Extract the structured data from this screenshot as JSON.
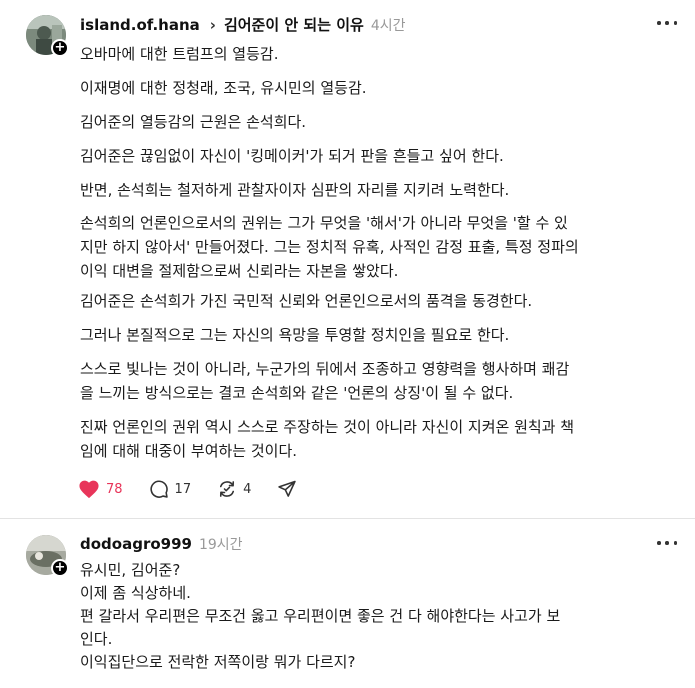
{
  "post": {
    "username": "island.of.hana",
    "separator": "›",
    "topic": "김어준이 안 되는 이유",
    "time": "4시간",
    "paragraphs": [
      "오바마에 대한 트럼프의 열등감.",
      "이재명에 대한 정청래, 조국, 유시민의 열등감.",
      "김어준의 열등감의 근원은 손석희다.",
      "김어준은 끊임없이 자신이 '킹메이커'가 되거 판을 흔들고 싶어 한다.",
      "반면, 손석희는 철저하게 관찰자이자 심판의 자리를 지키려 노력한다.",
      "손석희의 언론인으로서의 권위는 그가 무엇을 '해서'가 아니라 무엇을 '할 수 있",
      "지만 하지 않아서' 만들어졌다. 그는 정치적 유혹, 사적인 감정 표출, 특정 정파의",
      "이익 대변을 절제함으로써 신뢰라는 자본을 쌓았다.",
      "김어준은 손석희가 가진 국민적 신뢰와 언론인으로서의 품격을 동경한다.",
      "그러나 본질적으로 그는 자신의 욕망을 투영할 정치인을 필요로 한다.",
      "스스로 빛나는 것이 아니라, 누군가의 뒤에서 조종하고 영향력을 행사하며 쾌감",
      "을 느끼는 방식으로는 결코 손석희와 같은 '언론의 상징'이 될 수 없다.",
      "진짜 언론인의 권위 역시 스스로 주장하는 것이 아니라 자신이 지켜온 원칙과 책",
      "임에 대해 대중이 부여하는 것이다."
    ],
    "likes": "78",
    "comments": "17",
    "reposts": "4",
    "like_color": "#e8355a"
  },
  "reply": {
    "username": "dodoagro999",
    "time": "19시간",
    "lines": [
      "유시민, 김어준?",
      "이제 좀 식상하네.",
      "편 갈라서 우리편은 무조건 옳고 우리편이면 좋은 건 다 해야한다는 사고가 보",
      "인다.",
      "이익집단으로 전락한 저쪽이랑 뭐가 다르지?"
    ]
  }
}
